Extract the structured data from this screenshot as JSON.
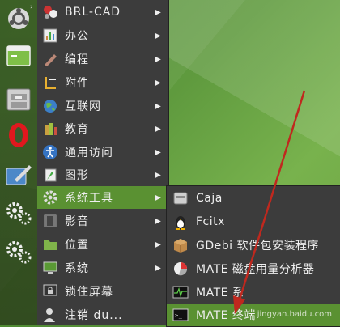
{
  "menu": {
    "items": [
      {
        "label": "BRL-CAD",
        "icon": "brlcad-icon",
        "has_submenu": true
      },
      {
        "label": "办公",
        "icon": "office-icon",
        "has_submenu": true
      },
      {
        "label": "编程",
        "icon": "programming-icon",
        "has_submenu": true
      },
      {
        "label": "附件",
        "icon": "accessories-icon",
        "has_submenu": true
      },
      {
        "label": "互联网",
        "icon": "internet-icon",
        "has_submenu": true
      },
      {
        "label": "教育",
        "icon": "education-icon",
        "has_submenu": true
      },
      {
        "label": "通用访问",
        "icon": "accessibility-icon",
        "has_submenu": true
      },
      {
        "label": "图形",
        "icon": "graphics-icon",
        "has_submenu": true
      },
      {
        "label": "系统工具",
        "icon": "system-tools-icon",
        "has_submenu": true,
        "active": true
      },
      {
        "label": "影音",
        "icon": "multimedia-icon",
        "has_submenu": true
      },
      {
        "label": "位置",
        "icon": "places-icon",
        "has_submenu": true
      },
      {
        "label": "系统",
        "icon": "system-icon",
        "has_submenu": true
      },
      {
        "label": "锁住屏幕",
        "icon": "lock-screen-icon",
        "has_submenu": false
      },
      {
        "label": "注销 du...",
        "icon": "logout-icon",
        "has_submenu": false
      }
    ]
  },
  "submenu": {
    "items": [
      {
        "label": "Caja",
        "icon": "caja-icon"
      },
      {
        "label": "Fcitx",
        "icon": "fcitx-icon"
      },
      {
        "label": "GDebi 软件包安装程序",
        "icon": "gdebi-icon"
      },
      {
        "label": "MATE 磁盘用量分析器",
        "icon": "disk-usage-icon"
      },
      {
        "label": "MATE 系",
        "icon": "system-monitor-icon"
      },
      {
        "label": "MATE 终端",
        "icon": "terminal-icon",
        "active": true
      }
    ]
  },
  "watermark": "jingyan.baidu.com",
  "colors": {
    "menu_bg": "#3c3c3c",
    "highlight": "#5a9132",
    "annotation_arrow": "#c0281e"
  }
}
